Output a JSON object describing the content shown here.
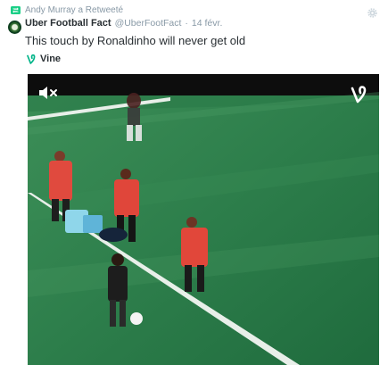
{
  "retweet": {
    "text": "Andy Murray a Retweeté",
    "icon": "retweet-icon"
  },
  "tweet": {
    "author_name": "Uber Football Fact",
    "handle": "@UberFootFact",
    "separator": "·",
    "date": "14 févr.",
    "text": "This touch by Ronaldinho will never get old"
  },
  "card": {
    "label": "Vine",
    "icon": "vine-icon"
  },
  "video": {
    "mute_icon": "speaker-muted-icon",
    "logo_icon": "vine-logo-icon"
  },
  "colors": {
    "vine_green": "#00b488",
    "muted_text": "#8899a6",
    "text": "#292f33",
    "pitch": "#2a7a47"
  }
}
